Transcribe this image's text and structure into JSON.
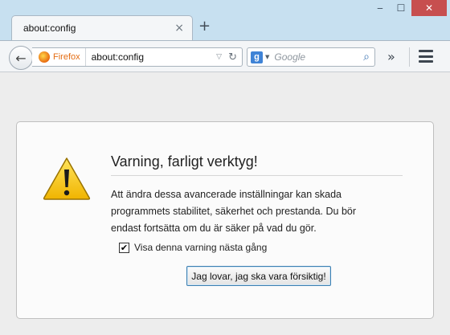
{
  "tab": {
    "title": "about:config",
    "close_glyph": "×"
  },
  "newtab_glyph": "+",
  "window_controls": {
    "minimize": "‒",
    "maximize": "☐",
    "close": "✕"
  },
  "navbar": {
    "back_glyph": "←",
    "identity_label": "Firefox",
    "url": "about:config",
    "dropmarker_glyph": "▽",
    "reload_glyph": "↻",
    "search_engine_letter": "g",
    "search_placeholder": "Google",
    "search_glyph": "⌕",
    "overflow_glyph": "»"
  },
  "warning": {
    "title": "Varning, farligt verktyg!",
    "text": "Att ändra dessa avancerade inställningar kan skada programmets stabilitet, säkerhet och prestanda. Du bör endast fortsätta om du är säker på vad du gör.",
    "checkbox_label": "Visa denna varning nästa gång",
    "checkbox_checked": true,
    "checkbox_glyph": "✔",
    "button_label": "Jag lovar, jag ska vara försiktig!"
  },
  "colors": {
    "chrome": "#c7e0f0",
    "close_button": "#c74f4f",
    "firefox_label": "#e46d14",
    "warning_yellow": "#f5c400",
    "button_focus_border": "#3c7fb1"
  },
  "icons": {
    "warning": "warning-triangle-icon",
    "identity": "firefox-icon",
    "search_engine": "google-icon",
    "search": "magnifier-icon",
    "menu": "hamburger-menu-icon"
  }
}
